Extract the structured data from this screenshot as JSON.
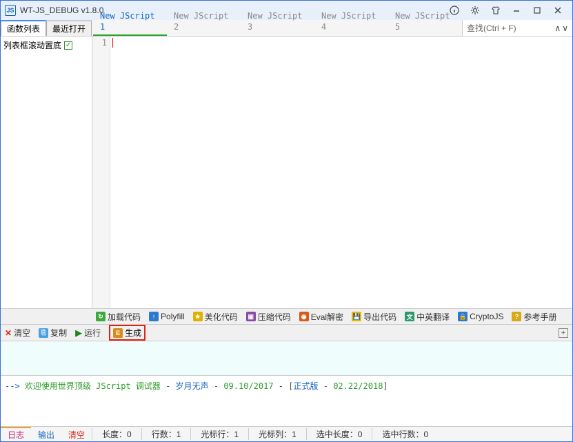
{
  "title": "WT-JS_DEBUG v1.8.0",
  "sidebarTabs": {
    "funcs": "函数列表",
    "recent": "最近打开"
  },
  "sidebarCheck": "列表框滚动置底",
  "editorTabs": [
    "New JScript 1",
    "New JScript 2",
    "New JScript 3",
    "New JScript 4",
    "New JScript 5"
  ],
  "searchPlaceholder": "查找(Ctrl + F)",
  "gutterLine": "1",
  "midToolbar": {
    "load": "加载代码",
    "polyfill": "Polyfill",
    "beautify": "美化代码",
    "compress": "压缩代码",
    "eval": "Eval解密",
    "export": "导出代码",
    "translate": "中英翻译",
    "crypto": "CryptoJS",
    "help": "参考手册"
  },
  "outToolbar": {
    "clear": "清空",
    "copy": "复制",
    "run": "运行",
    "gen": "生成"
  },
  "welcome": {
    "arrow": "--> ",
    "p1": "欢迎使用世界顶级 JScript 调试器",
    "d1": " - ",
    "p2": "岁月无声",
    "d2": " - ",
    "p3": "09.10/2017",
    "d3": " - [",
    "p4": "正式版",
    "d4": " - ",
    "p5": "02.22/2018",
    "d5": "]"
  },
  "bottomTabs": {
    "log": "日志",
    "output": "输出",
    "clear": "清空"
  },
  "status": {
    "len": "长度：0",
    "lines": "行数：1",
    "cursorLine": "光标行：1",
    "cursorCol": "光标列：1",
    "selLen": "选中长度：0",
    "selLines": "选中行数：0"
  }
}
